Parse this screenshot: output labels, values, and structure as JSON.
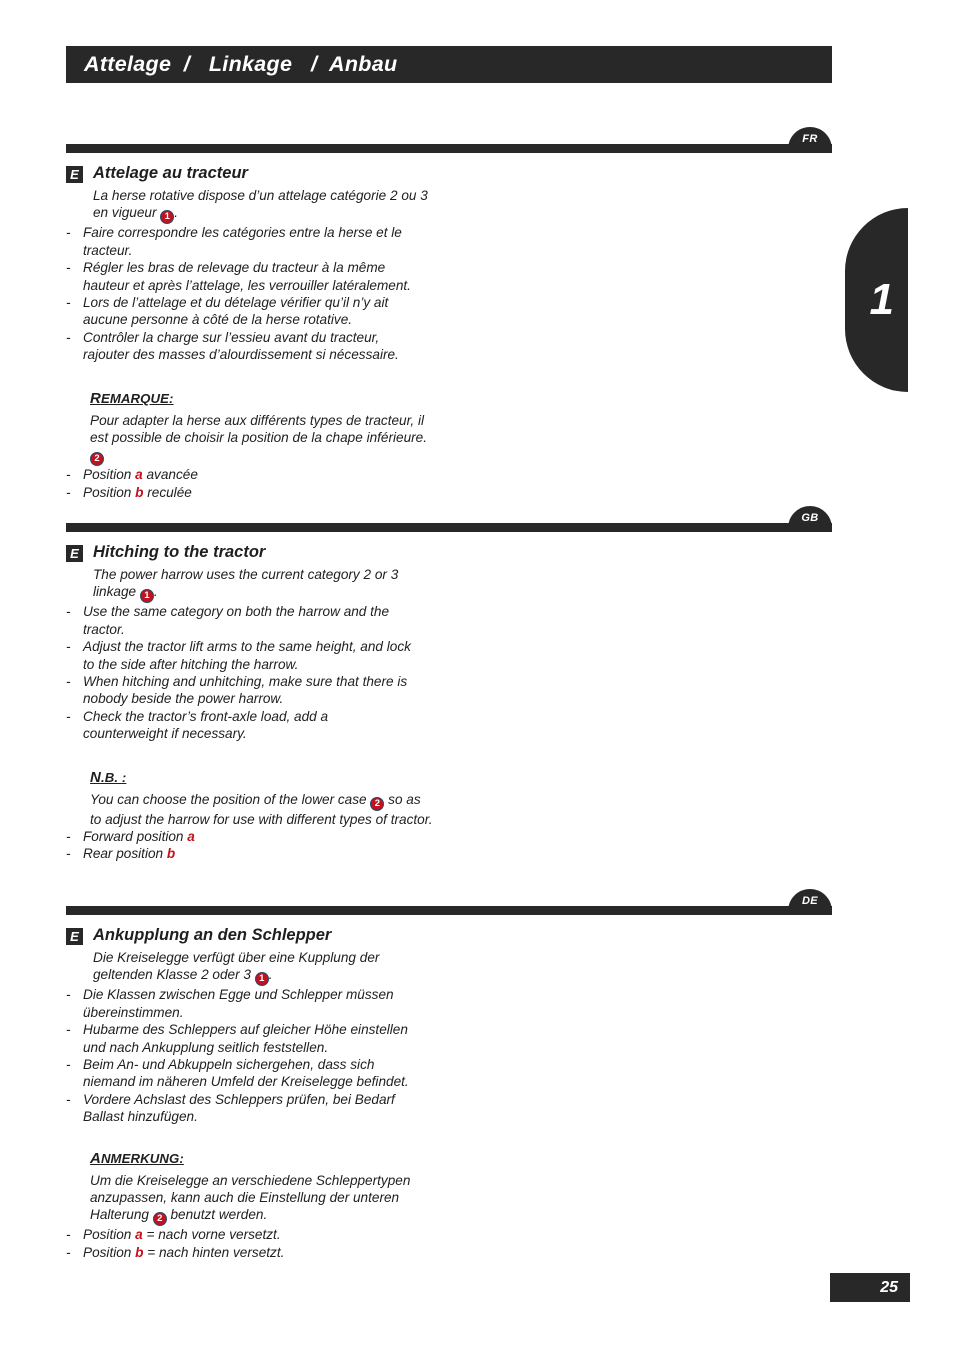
{
  "header": {
    "title": "Attelage  /   Linkage   /  Anbau"
  },
  "chapter_tab": {
    "number": "1"
  },
  "footer": {
    "page_number": "25"
  },
  "sections": [
    {
      "lang_code": "FR",
      "badge": "E",
      "heading": "Attelage au tracteur",
      "intro_pre": "La herse rotative dispose d’un attelage catégorie 2 ou 3 en vigueur ",
      "intro_marker": "1",
      "intro_post": ".",
      "bullets": [
        "Faire correspondre les catégories entre la herse et le tracteur.",
        "Régler les bras de relevage du tracteur à la même hauteur et après l’attelage, les verrouiller latéralement.",
        "Lors de l’attelage et du dételage vérifier qu’il n’y ait aucune personne à côté de la herse rotative.",
        "Contrôler la charge sur l’essieu avant du tracteur, rajouter des masses d’alourdissement si nécessaire."
      ],
      "note_label_first": "R",
      "note_label_rest": "EMARQUE",
      "note_label_colon": ":",
      "note_pre": "Pour adapter la herse aux différents types de tracteur, il est possible de choisir la position de la chape inférieure. ",
      "note_marker": "2",
      "note_post": "",
      "sub_bullets": [
        {
          "pre": "Position ",
          "letter": "a",
          "post": " avancée"
        },
        {
          "pre": "Position ",
          "letter": "b",
          "post": " reculée"
        }
      ]
    },
    {
      "lang_code": "GB",
      "badge": "E",
      "heading": "Hitching to the tractor",
      "intro_pre": "The power harrow uses the current category 2 or 3 linkage ",
      "intro_marker": "1",
      "intro_post": ".",
      "bullets": [
        "Use the same category on both the harrow and the tractor.",
        "Adjust the tractor lift arms to the same height, and lock to the side after hitching the harrow.",
        "When hitching and unhitching, make sure that there is nobody beside the power harrow.",
        "Check the tractor’s front-axle load, add a counterweight if necessary."
      ],
      "note_label_first": "N",
      "note_label_rest": ".B. ",
      "note_label_colon": ":",
      "note_pre": "You can choose the position of the lower case ",
      "note_marker": "2",
      "note_post": " so as to adjust the harrow for use with different types of tractor.",
      "sub_bullets": [
        {
          "pre": "Forward position ",
          "letter": "a",
          "post": ""
        },
        {
          "pre": "Rear position ",
          "letter": "b",
          "post": ""
        }
      ]
    },
    {
      "lang_code": "DE",
      "badge": "E",
      "heading": "Ankupplung an den Schlepper",
      "intro_pre": "Die Kreiselegge verfügt über eine Kupplung der geltenden Klasse 2 oder 3 ",
      "intro_marker": "1",
      "intro_post": ".",
      "bullets": [
        "Die Klassen zwischen Egge und Schlepper müssen übereinstimmen.",
        "Hubarme des Schleppers auf gleicher Höhe einstellen und nach Ankupplung seitlich feststellen.",
        "Beim An- und Abkuppeln sichergehen, dass sich niemand im näheren Umfeld der Kreiselegge befindet.",
        "Vordere Achslast des Schleppers prüfen, bei Bedarf Ballast hinzufügen."
      ],
      "note_label_first": "A",
      "note_label_rest": "NMERKUNG",
      "note_label_colon": ":",
      "note_pre": "Um die Kreiselegge an verschiedene Schleppertypen anzupassen, kann auch die Einstellung der unteren Halterung ",
      "note_marker": "2",
      "note_post": " benutzt werden.",
      "sub_bullets": [
        {
          "pre": "Position ",
          "letter": "a",
          "post": " = nach vorne versetzt."
        },
        {
          "pre": "Position ",
          "letter": "b",
          "post": " = nach hinten versetzt."
        }
      ]
    }
  ]
}
